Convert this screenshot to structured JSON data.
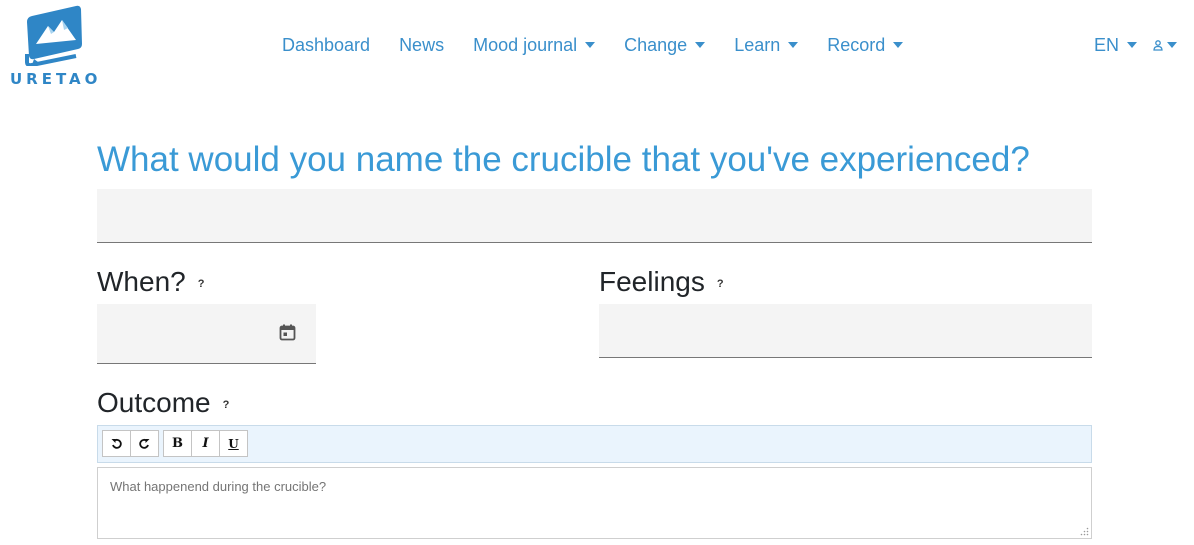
{
  "brand": {
    "name": "URETAO"
  },
  "nav": {
    "items": [
      {
        "label": "Dashboard",
        "dropdown": false
      },
      {
        "label": "News",
        "dropdown": false
      },
      {
        "label": "Mood journal",
        "dropdown": true
      },
      {
        "label": "Change",
        "dropdown": true
      },
      {
        "label": "Learn",
        "dropdown": true
      },
      {
        "label": "Record",
        "dropdown": true
      }
    ],
    "language": "EN",
    "user_icon": "user-icon"
  },
  "form": {
    "title": "What would you name the crucible that you've experienced?",
    "title_value": "",
    "when_label": "When?",
    "when_help": "?",
    "when_value": "",
    "feelings_label": "Feelings",
    "feelings_help": "?",
    "feelings_value": "",
    "outcome_label": "Outcome",
    "outcome_help": "?",
    "outcome_placeholder": "What happenend during the crucible?",
    "toolbar": {
      "bold": "B",
      "italic": "I",
      "underline": "U"
    }
  },
  "colors": {
    "accent": "#3a8fcb",
    "title": "#3a9ad6",
    "field_bg": "#f4f4f4",
    "toolbar_bg": "#eaf4fd"
  }
}
